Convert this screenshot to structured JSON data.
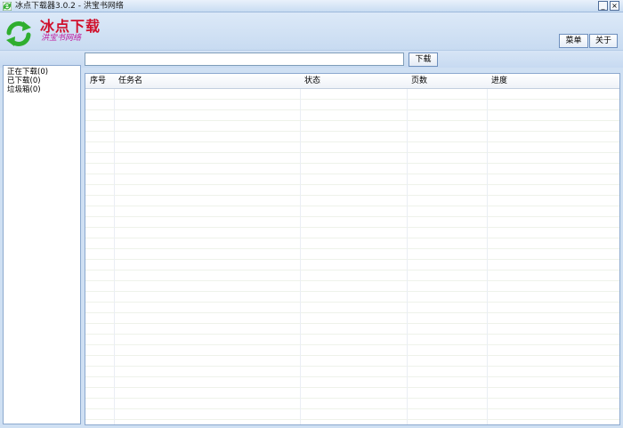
{
  "window": {
    "title": "冰点下载器3.0.2 - 洪宝书网络",
    "minimize_glyph": "_",
    "close_glyph": "×"
  },
  "header": {
    "app_name": "冰点下载",
    "brand": "洪宝书网络",
    "logo_icon": "refresh-arrows-icon",
    "menu_label": "菜单",
    "about_label": "关于"
  },
  "search": {
    "value": "",
    "placeholder": "",
    "download_label": "下载"
  },
  "sidebar": {
    "items": [
      {
        "label": "正在下载(0)"
      },
      {
        "label": "已下载(0)"
      },
      {
        "label": "垃圾箱(0)"
      }
    ]
  },
  "table": {
    "columns": [
      {
        "label": "序号"
      },
      {
        "label": "任务名"
      },
      {
        "label": "状态"
      },
      {
        "label": "页数"
      },
      {
        "label": "进度"
      }
    ],
    "rows": []
  },
  "colors": {
    "accent_red": "#d0102c",
    "brand_magenta": "#c01a9e",
    "logo_green": "#2fae2f",
    "frame_blue": "#cfe0f3"
  }
}
